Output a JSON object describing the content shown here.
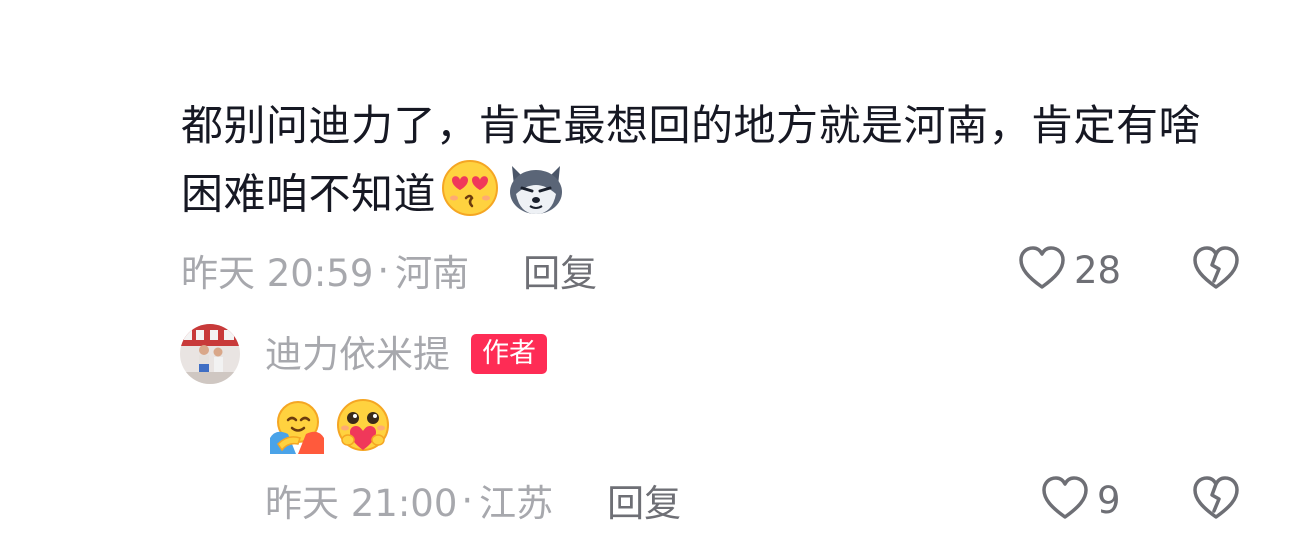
{
  "comment": {
    "text": "都别问迪力了，肯定最想回的地方就是河南，肯定有啥困难咱不知道",
    "emojis": [
      "heart-eyes-kiss-emoji",
      "husky-dog-emoji"
    ],
    "time": "昨天 20:59",
    "separator": "·",
    "location": "河南",
    "reply_label": "回复",
    "like_count": "28"
  },
  "reply": {
    "author_name": "迪力依米提",
    "author_badge": "作者",
    "emojis": [
      "hug-emoji",
      "heart-hands-emoji"
    ],
    "time": "昨天 21:00",
    "separator": "·",
    "location": "江苏",
    "reply_label": "回复",
    "like_count": "9"
  },
  "colors": {
    "text_primary": "#161823",
    "text_secondary": "#a7a8ad",
    "accent": "#fe2c55"
  }
}
